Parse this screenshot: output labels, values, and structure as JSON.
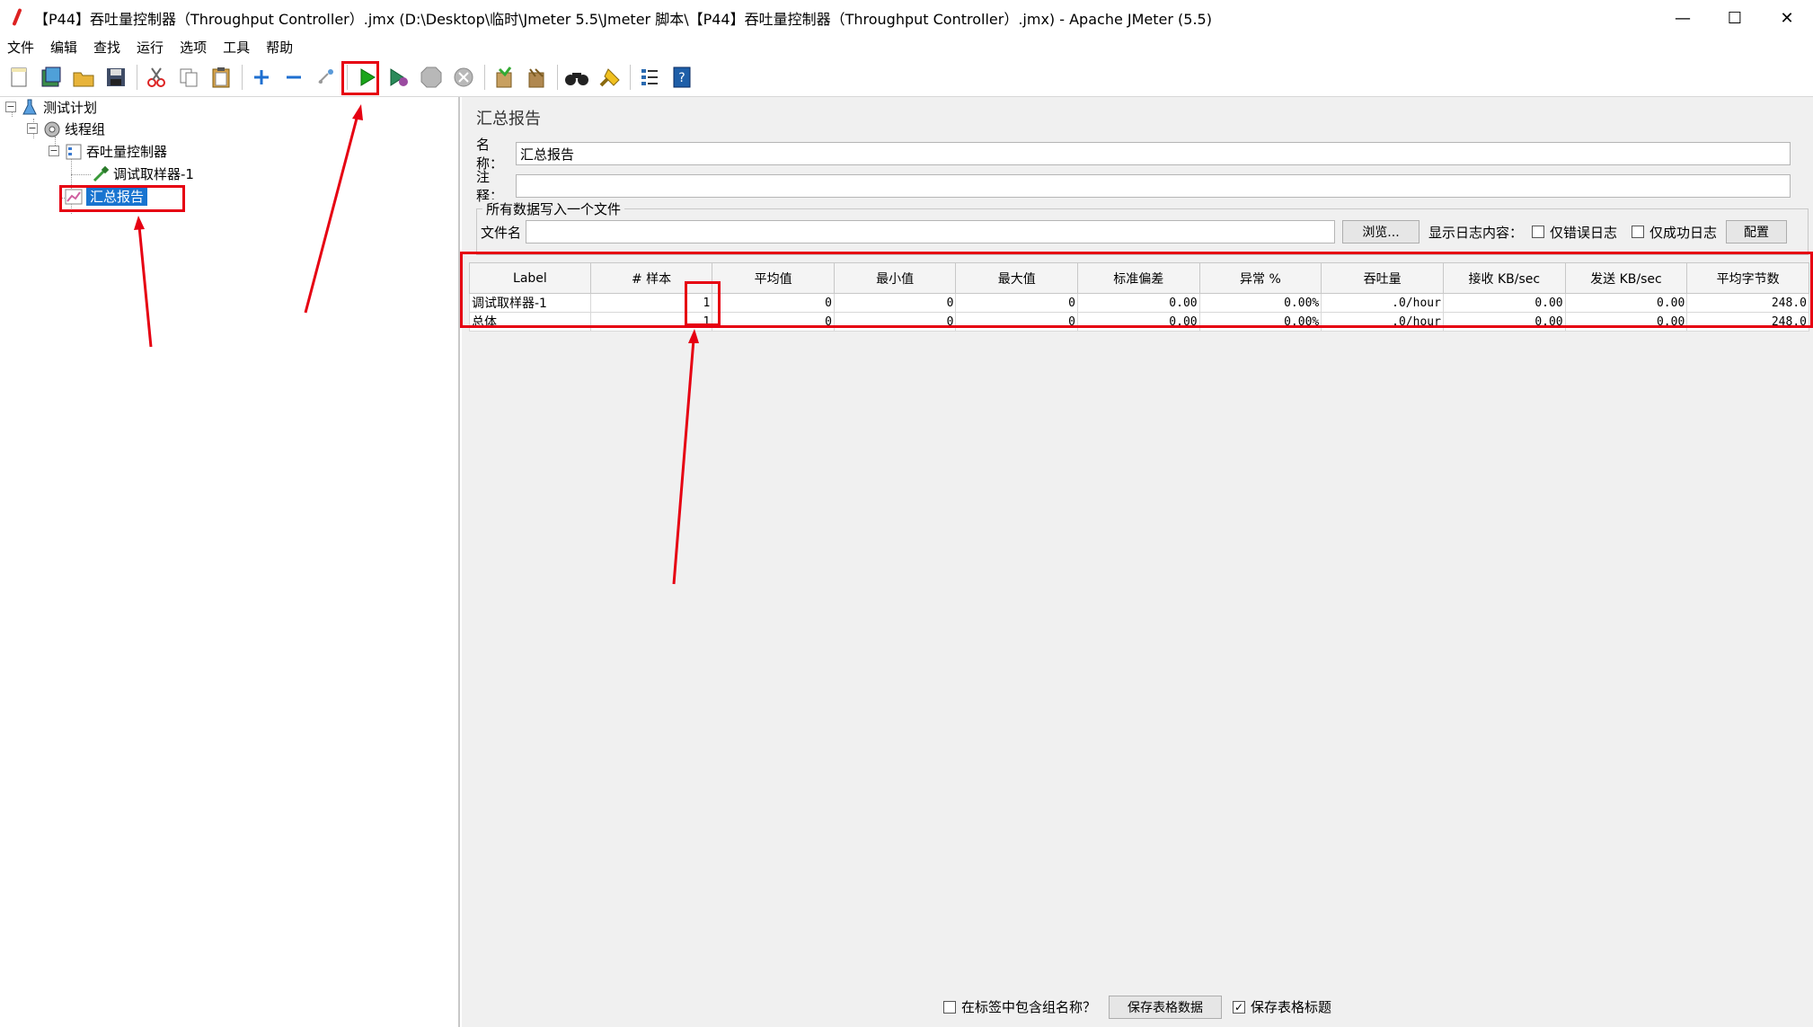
{
  "window": {
    "title": "【P44】吞吐量控制器（Throughput Controller）.jmx (D:\\Desktop\\临时\\Jmeter 5.5\\Jmeter 脚本\\【P44】吞吐量控制器（Throughput Controller）.jmx) - Apache JMeter (5.5)",
    "minimize": "—",
    "maximize": "☐",
    "close": "✕"
  },
  "menu": [
    "文件",
    "编辑",
    "查找",
    "运行",
    "选项",
    "工具",
    "帮助"
  ],
  "toolbar": {
    "icons": [
      "new-icon",
      "templates-icon",
      "open-icon",
      "save-icon",
      "cut-icon",
      "copy-icon",
      "paste-icon",
      "expand-icon",
      "collapse-icon",
      "toggle-icon",
      "start-icon",
      "start-no-pause-icon",
      "stop-icon",
      "shutdown-icon",
      "clear-icon",
      "clear-all-icon",
      "search-icon",
      "reset-search-icon",
      "function-helper-icon",
      "help-icon"
    ]
  },
  "tree": {
    "test_plan": "测试计划",
    "thread_group": "线程组",
    "throughput_controller": "吞吐量控制器",
    "debug_sampler": "调试取样器-1",
    "summary_report": "汇总报告"
  },
  "panel": {
    "title": "汇总报告",
    "name_label": "名称：",
    "name_value": "汇总报告",
    "comment_label": "注释：",
    "comment_value": "",
    "file_group_title": "所有数据写入一个文件",
    "filename_label": "文件名",
    "filename_value": "",
    "browse_button": "浏览...",
    "log_display_label": "显示日志内容：",
    "errors_only": "仅错误日志",
    "success_only": "仅成功日志",
    "configure_button": "配置"
  },
  "table": {
    "columns": [
      "Label",
      "# 样本",
      "平均值",
      "最小值",
      "最大值",
      "标准偏差",
      "异常 %",
      "吞吐量",
      "接收 KB/sec",
      "发送 KB/sec",
      "平均字节数"
    ],
    "rows": [
      [
        "调试取样器-1",
        "1",
        "0",
        "0",
        "0",
        "0.00",
        "0.00%",
        ".0/hour",
        "0.00",
        "0.00",
        "248.0"
      ],
      [
        "总体",
        "1",
        "0",
        "0",
        "0",
        "0.00",
        "0.00%",
        ".0/hour",
        "0.00",
        "0.00",
        "248.0"
      ]
    ]
  },
  "bottom": {
    "include_group_name": "在标签中包含组名称？",
    "save_table_data": "保存表格数据",
    "save_table_header": "保存表格标题"
  },
  "colors": {
    "annotation": "#e60012",
    "selection": "#1874d0"
  }
}
